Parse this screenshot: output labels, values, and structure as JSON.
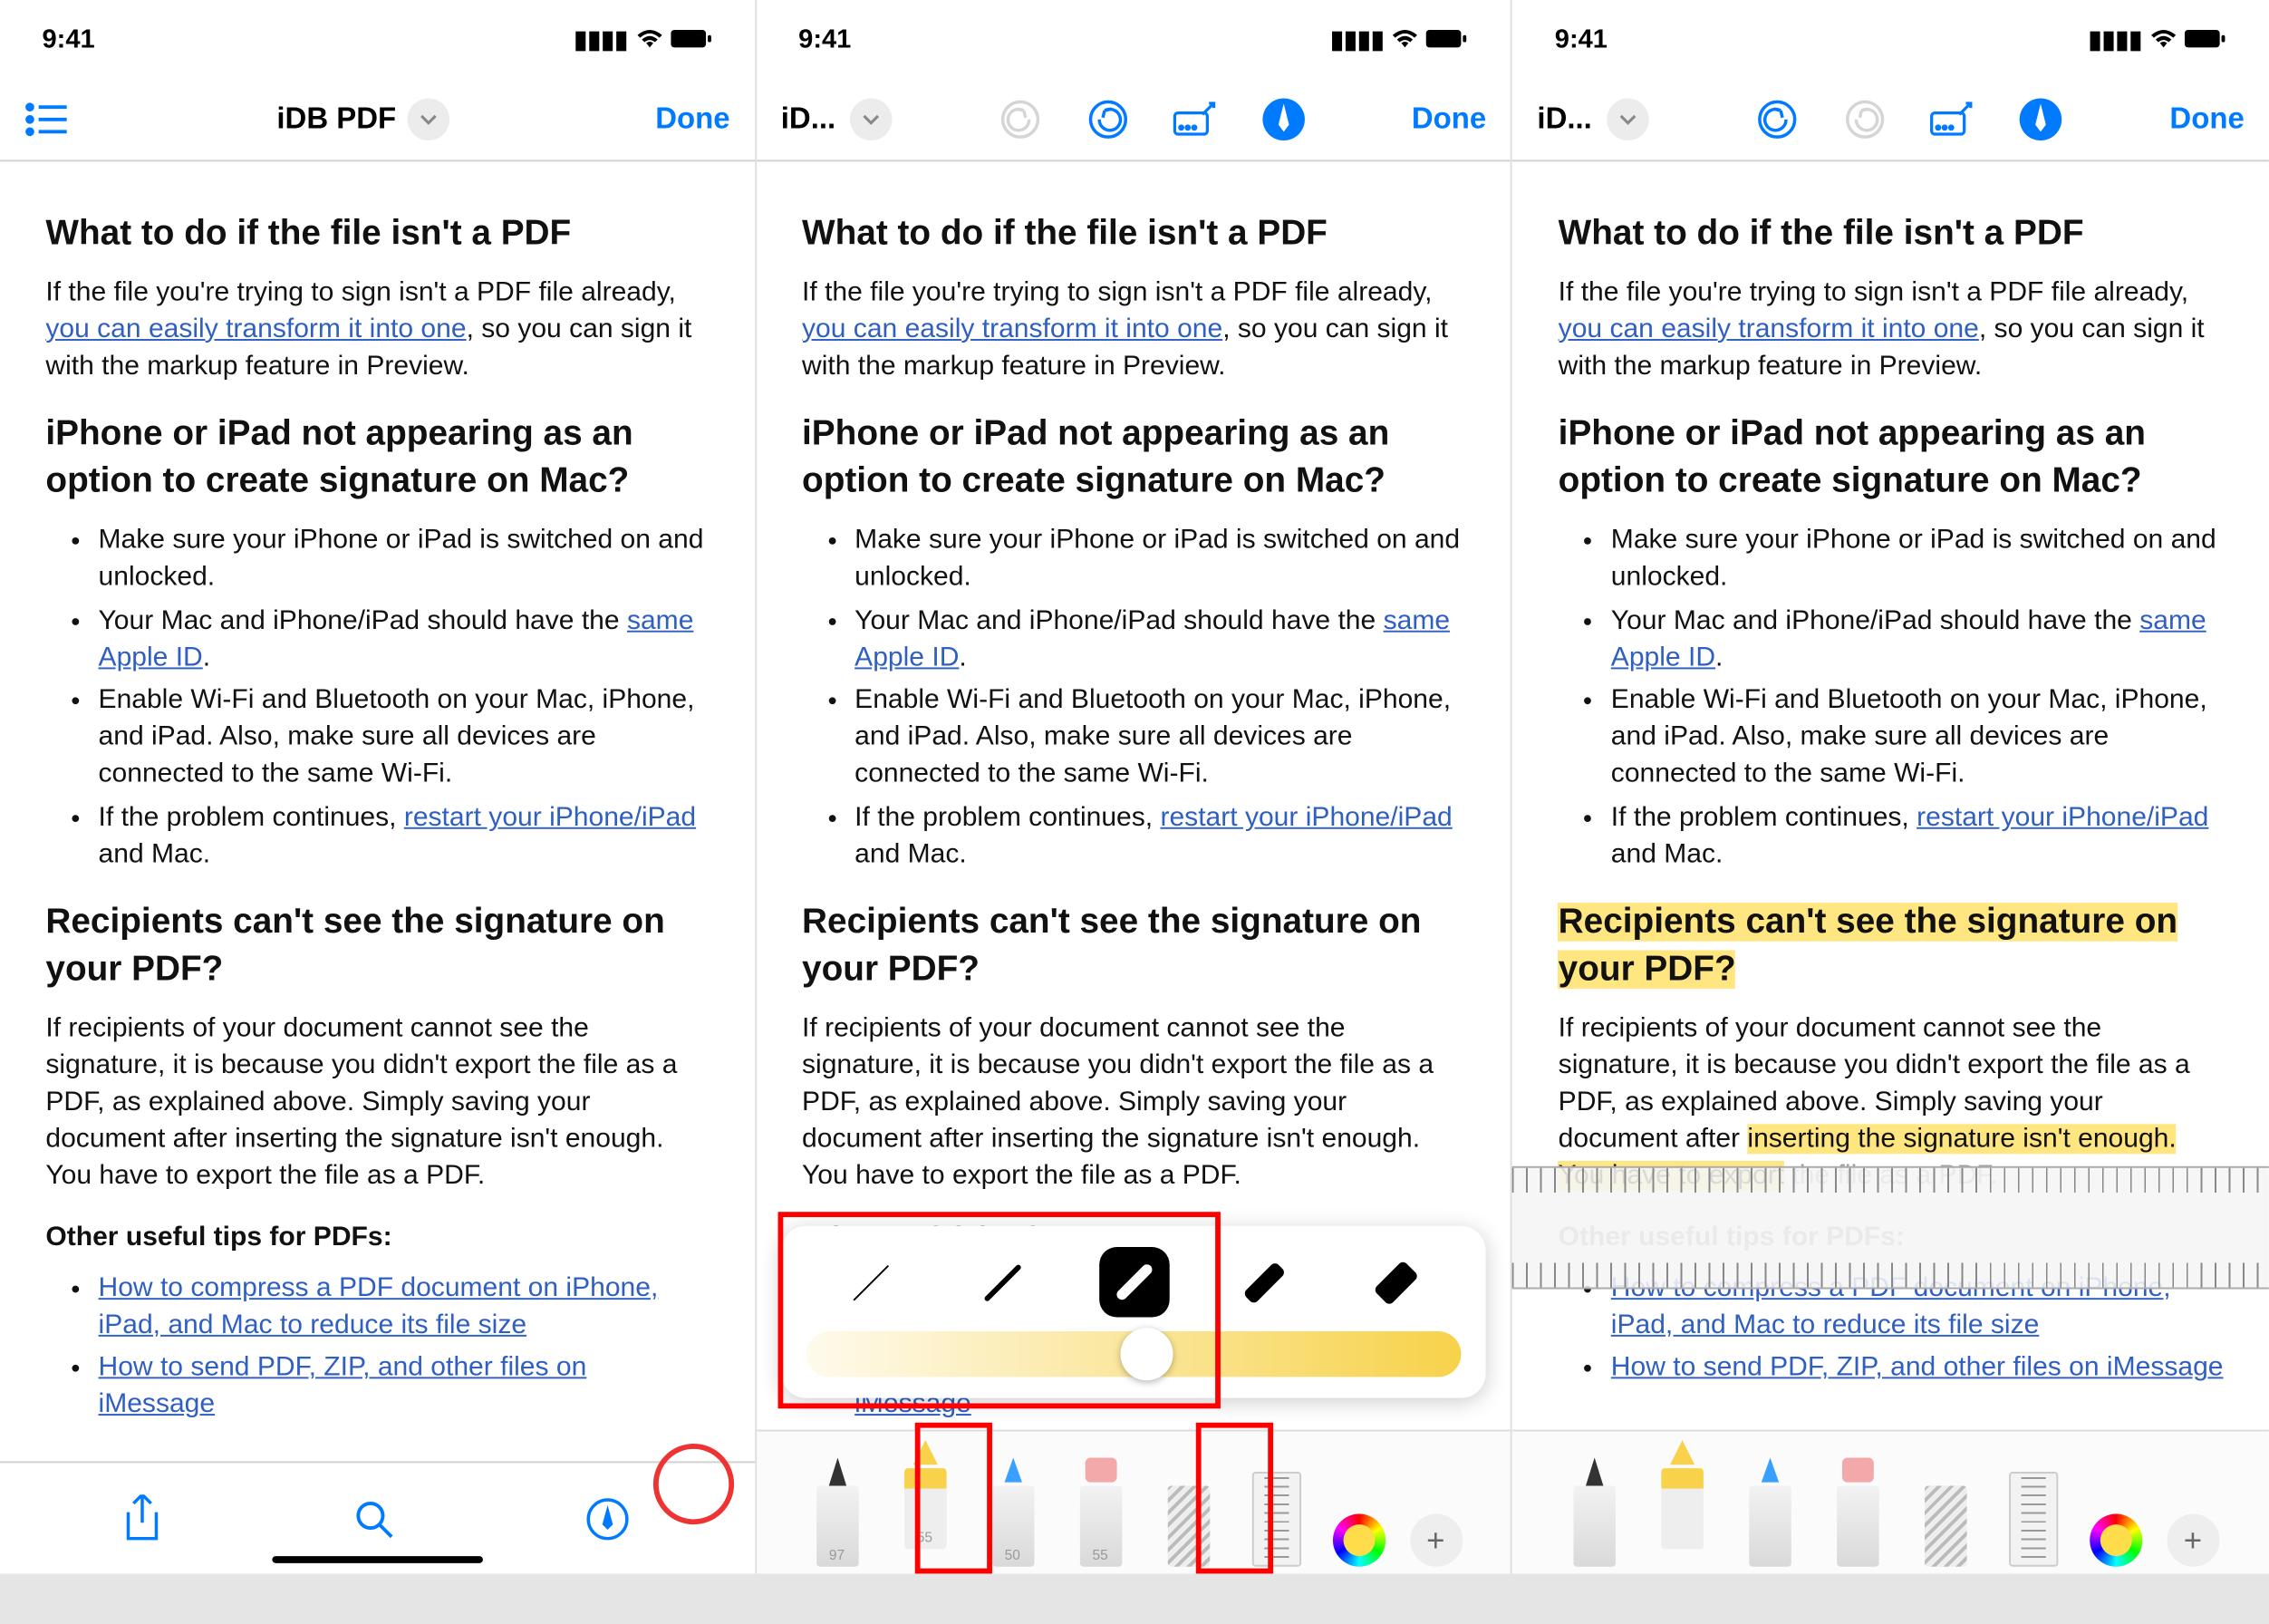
{
  "status": {
    "time": "9:41"
  },
  "nav": {
    "title_full": "iDB PDF",
    "title_short": "iD...",
    "done": "Done"
  },
  "doc": {
    "h1": "What to do if the file isn't a PDF",
    "p1a": "If the file you're trying to sign isn't a PDF file already, ",
    "p1link": "you can easily transform it into one",
    "p1b": ", so you can sign it with the markup feature in Preview.",
    "h2": "iPhone or iPad not appearing as an option to create signature on Mac?",
    "li1": "Make sure your iPhone or iPad is switched on and unlocked.",
    "li2a": "Your Mac and iPhone/iPad should have the ",
    "li2link": "same Apple ID",
    "li2b": ".",
    "li3": "Enable Wi-Fi and Bluetooth on your Mac, iPhone, and iPad. Also, make sure all devices are connected to the same Wi-Fi.",
    "li4a": "If the problem continues, ",
    "li4link": "restart your iPhone/iPad",
    "li4b": " and Mac.",
    "h3": "Recipients can't see the signature on your PDF?",
    "p2": "If recipients of your document cannot see the signature, it is because you didn't export the file as a PDF, as explained above. Simply saving your document after inserting the signature isn't enough. You have to export the file as a PDF.",
    "h4": "Other useful tips for PDFs:",
    "tip1": "How to compress a PDF document on iPhone, iPad, and Mac to reduce its file size",
    "tip2": "How to send PDF, ZIP, and other files on iMessage",
    "p2_hl_a": "If recipients of your document cannot see the signature, it is because you didn't export the file as a PDF, as explained above. Simply saving your document after ",
    "p2_hl_b": "inserting the signature isn't enough. You have to export",
    "p2_hl_c": " the file as a PDF."
  },
  "tools": {
    "pen_size": "97",
    "hi_size": "55",
    "pc_size": "50",
    "er_size": "55"
  }
}
